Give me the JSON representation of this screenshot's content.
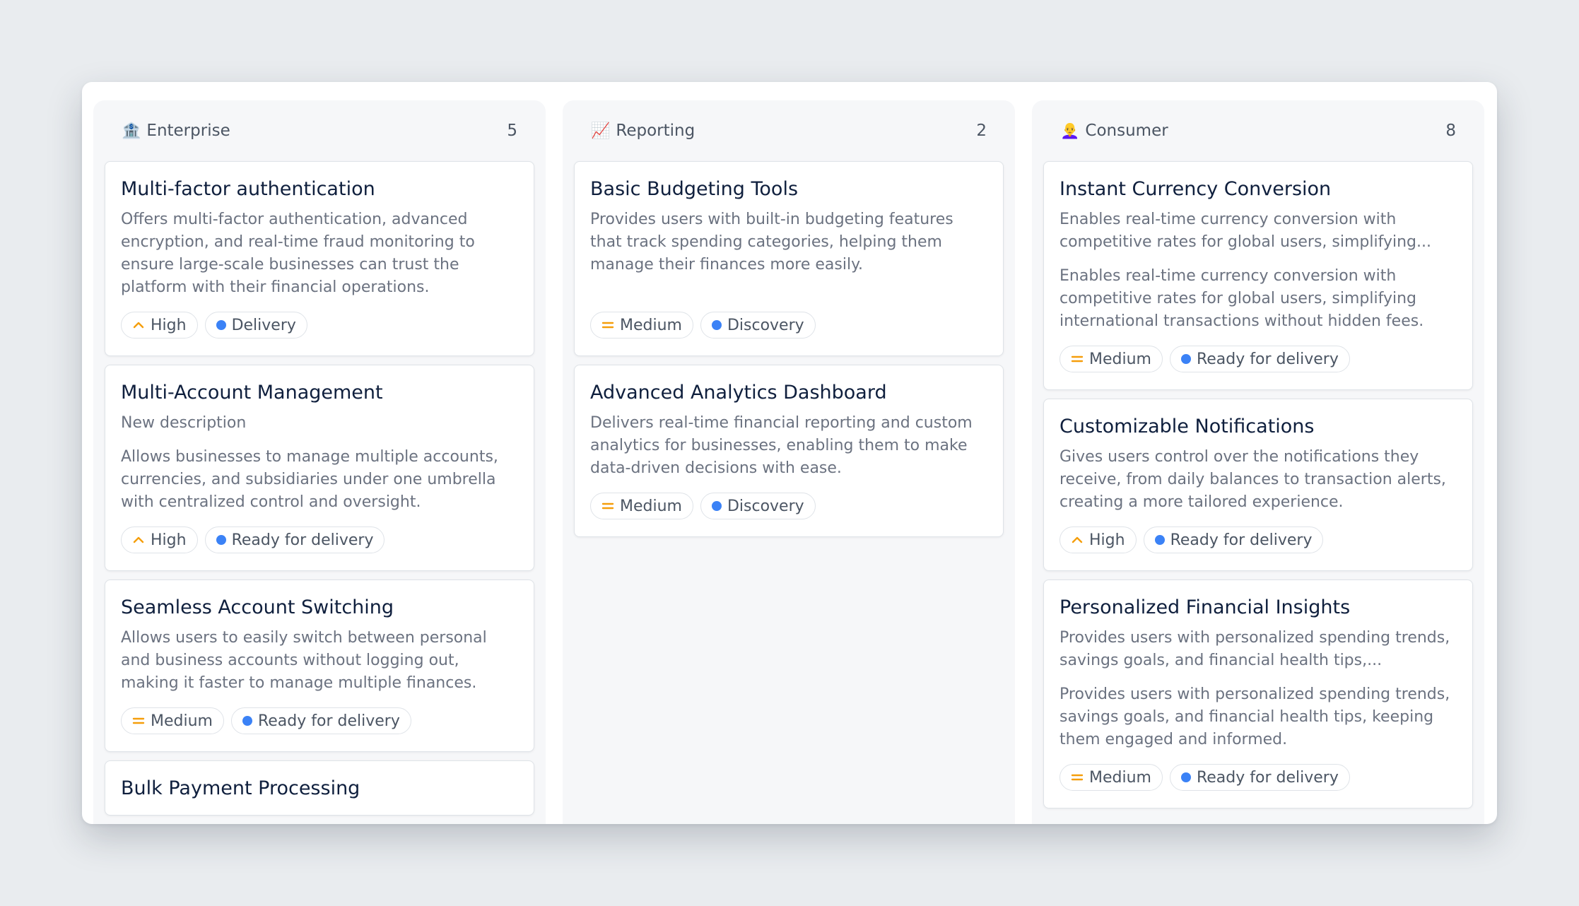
{
  "colors": {
    "accent_blue": "#3b82f6",
    "priority_orange": "#f59e0b",
    "title_navy": "#0f1f3d"
  },
  "columns": [
    {
      "emoji": "🏦",
      "title": "Enterprise",
      "count": "5",
      "cards": [
        {
          "title": "Multi-factor authentication",
          "subtitle": "",
          "description": "Offers multi-factor authentication, advanced encryption, and real-time fraud monitoring to ensure large-scale businesses can trust the platform with their financial operations.",
          "priority": "High",
          "priority_icon": "chevron-up-icon",
          "status": "Delivery"
        },
        {
          "title": "Multi-Account Management",
          "subtitle": "New description",
          "description": "Allows businesses to manage multiple accounts, currencies, and subsidiaries under one umbrella with centralized control and oversight.",
          "priority": "High",
          "priority_icon": "chevron-up-icon",
          "status": "Ready for delivery"
        },
        {
          "title": "Seamless Account Switching",
          "subtitle": "",
          "description": "Allows users to easily switch between personal and business accounts without logging out, making it faster to manage multiple finances.",
          "priority": "Medium",
          "priority_icon": "equals-icon",
          "status": "Ready for delivery"
        },
        {
          "title": "Bulk Payment Processing"
        }
      ]
    },
    {
      "emoji": "📈",
      "title": "Reporting",
      "count": "2",
      "cards": [
        {
          "title": "Basic Budgeting Tools",
          "description": "Provides users with built-in budgeting features that track spending categories, helping them manage their finances more easily.",
          "priority": "Medium",
          "priority_icon": "equals-icon",
          "status": "Discovery"
        },
        {
          "title": "Advanced Analytics Dashboard",
          "description": "Delivers real-time financial reporting and custom analytics for businesses, enabling them to make data-driven decisions with ease.",
          "priority": "Medium",
          "priority_icon": "equals-icon",
          "status": "Discovery"
        }
      ]
    },
    {
      "emoji": "👩‍🦲",
      "title": "Consumer",
      "count": "8",
      "cards": [
        {
          "title": "Instant Currency Conversion",
          "subtitle": "Enables real-time currency conversion with competitive rates for global users, simplifying...",
          "description": "Enables real-time currency conversion with competitive rates for global users, simplifying international transactions without hidden fees.",
          "priority": "Medium",
          "priority_icon": "equals-icon",
          "status": "Ready for delivery"
        },
        {
          "title": "Customizable Notifications",
          "description": "Gives users control over the notifications they receive, from daily balances to transaction alerts, creating a more tailored experience.",
          "priority": "High",
          "priority_icon": "chevron-up-icon",
          "status": "Ready for delivery"
        },
        {
          "title": "Personalized Financial Insights",
          "subtitle": "Provides users with personalized spending trends, savings goals, and financial health tips,...",
          "description": "Provides users with personalized spending trends, savings goals, and financial health tips, keeping them engaged and informed.",
          "priority": "Medium",
          "priority_icon": "equals-icon",
          "status": "Ready for delivery"
        }
      ]
    }
  ]
}
